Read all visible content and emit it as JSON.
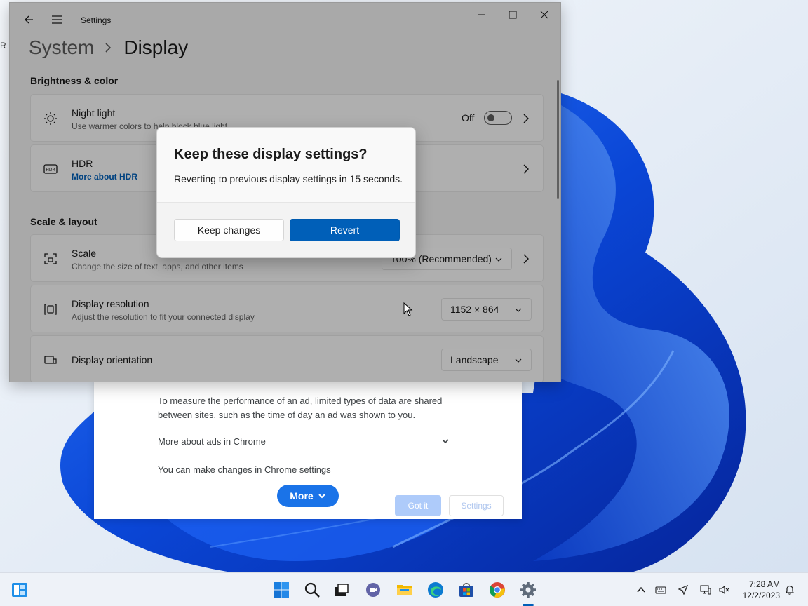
{
  "desktop": {
    "edge_label": "R"
  },
  "chrome_popup": {
    "paragraph": "To measure the performance of an ad, limited types of data are shared between sites, such as the time of day an ad was shown to you.",
    "more_about": "More about ads in Chrome",
    "changes_text": "You can make changes in Chrome settings",
    "more_button": "More",
    "got_it_button": "Got it",
    "settings_button": "Settings"
  },
  "settings": {
    "app_title": "Settings",
    "breadcrumb": {
      "parent": "System",
      "current": "Display"
    },
    "sections": {
      "brightness": "Brightness & color",
      "scale": "Scale & layout"
    },
    "night_light": {
      "title": "Night light",
      "subtitle": "Use warmer colors to help block blue light",
      "state_label": "Off"
    },
    "hdr": {
      "title": "HDR",
      "link": "More about HDR"
    },
    "scale": {
      "title": "Scale",
      "subtitle": "Change the size of text, apps, and other items",
      "value": "100% (Recommended)"
    },
    "resolution": {
      "title": "Display resolution",
      "subtitle": "Adjust the resolution to fit your connected display",
      "value": "1152 × 864"
    },
    "orientation": {
      "title": "Display orientation",
      "value": "Landscape"
    }
  },
  "dialog": {
    "title": "Keep these display settings?",
    "message": "Reverting to previous display settings in 15 seconds.",
    "keep_button": "Keep changes",
    "revert_button": "Revert"
  },
  "taskbar": {
    "time": "7:28 AM",
    "date": "12/2/2023",
    "pinned": [
      "widgets-icon",
      "start-icon",
      "search-icon",
      "task-view-icon",
      "teams-chat-icon",
      "file-explorer-icon",
      "edge-icon",
      "store-icon",
      "chrome-icon",
      "settings-icon"
    ]
  },
  "colors": {
    "accent": "#005fb8",
    "chrome_blue": "#1a73e8"
  }
}
